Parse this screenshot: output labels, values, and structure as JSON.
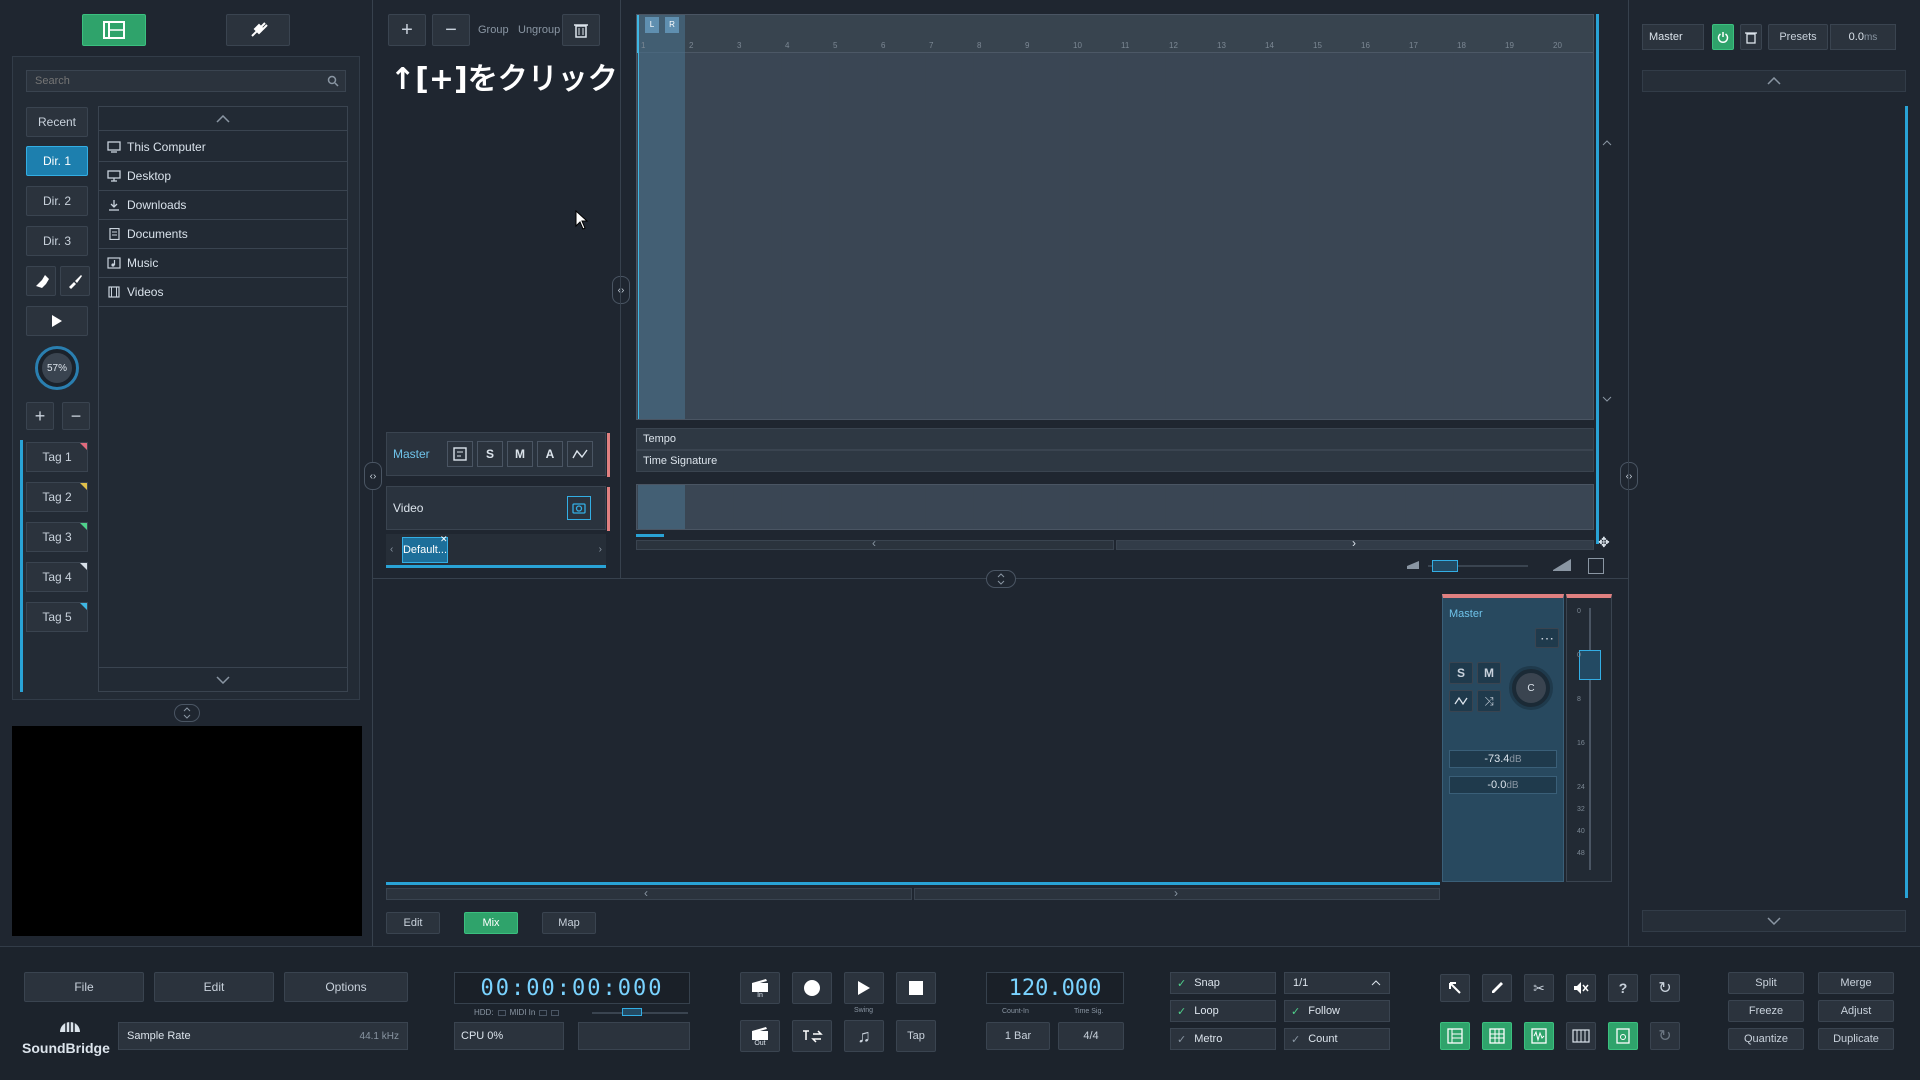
{
  "sidebar": {
    "search_placeholder": "Search",
    "dir_buttons": [
      "Recent",
      "Dir. 1",
      "Dir. 2",
      "Dir. 3"
    ],
    "knob_value": "57%",
    "tags": [
      "Tag 1",
      "Tag 2",
      "Tag 3",
      "Tag 4",
      "Tag 5"
    ],
    "tag_colors": [
      "#e06b7d",
      "#e0c04a",
      "#4fd18b",
      "#d8e0e8",
      "#3fb7e3"
    ],
    "locations": [
      "This Computer",
      "Desktop",
      "Downloads",
      "Documents",
      "Music",
      "Videos"
    ]
  },
  "toolbar": {
    "group_label": "Group",
    "ungroup_label": "Ungroup"
  },
  "annotation": "↑[+]をクリック",
  "arrange": {
    "loop_markers": [
      "L",
      "R"
    ],
    "ruler_numbers": [
      "1",
      "2",
      "3",
      "4",
      "5",
      "6",
      "7",
      "8",
      "9",
      "10",
      "11",
      "12",
      "13",
      "14",
      "15",
      "16",
      "17",
      "18",
      "19",
      "20"
    ],
    "tempo_label": "Tempo",
    "time_signature_label": "Time Signature"
  },
  "tracks": {
    "master_label": "Master",
    "master_buttons": [
      "S",
      "M",
      "A"
    ],
    "video_label": "Video",
    "default_tab": "Default..."
  },
  "mixer": {
    "channel_name": "Master",
    "pan_label": "C",
    "level_readout": "-73.4",
    "level_unit": "dB",
    "gain_readout": "-0.0",
    "gain_unit": "dB",
    "scale_ticks": [
      "0",
      "0",
      "8",
      "16",
      "24",
      "32",
      "40",
      "48"
    ]
  },
  "right_panel": {
    "channel": "Master",
    "presets_label": "Presets",
    "value": "0.0",
    "value_unit": "ms"
  },
  "bottom_tabs": [
    "Edit",
    "Mix",
    "Map"
  ],
  "transport": {
    "menu": [
      "File",
      "Edit",
      "Options"
    ],
    "brand": "SoundBridge",
    "sample_rate_label": "Sample Rate",
    "sample_rate_value": "44.1 kHz",
    "time_display": "00:00:00:000",
    "hdd_label": "HDD:",
    "midi_label": "MIDI In",
    "cpu_label": "CPU 0%",
    "in_label": "In",
    "out_label": "Out",
    "swing_label": "Swing",
    "tap_label": "Tap",
    "tempo_value": "120.000",
    "count_in_label": "Count-In",
    "count_in_value": "1 Bar",
    "time_sig_label": "Time Sig.",
    "time_sig_value": "4/4",
    "toggles": [
      "Snap",
      "Loop",
      "Metro"
    ],
    "grid_value": "1/1",
    "toggles2": [
      "Follow",
      "Count"
    ],
    "ops": [
      "Split",
      "Merge",
      "Freeze",
      "Adjust",
      "Quantize",
      "Duplicate"
    ]
  }
}
